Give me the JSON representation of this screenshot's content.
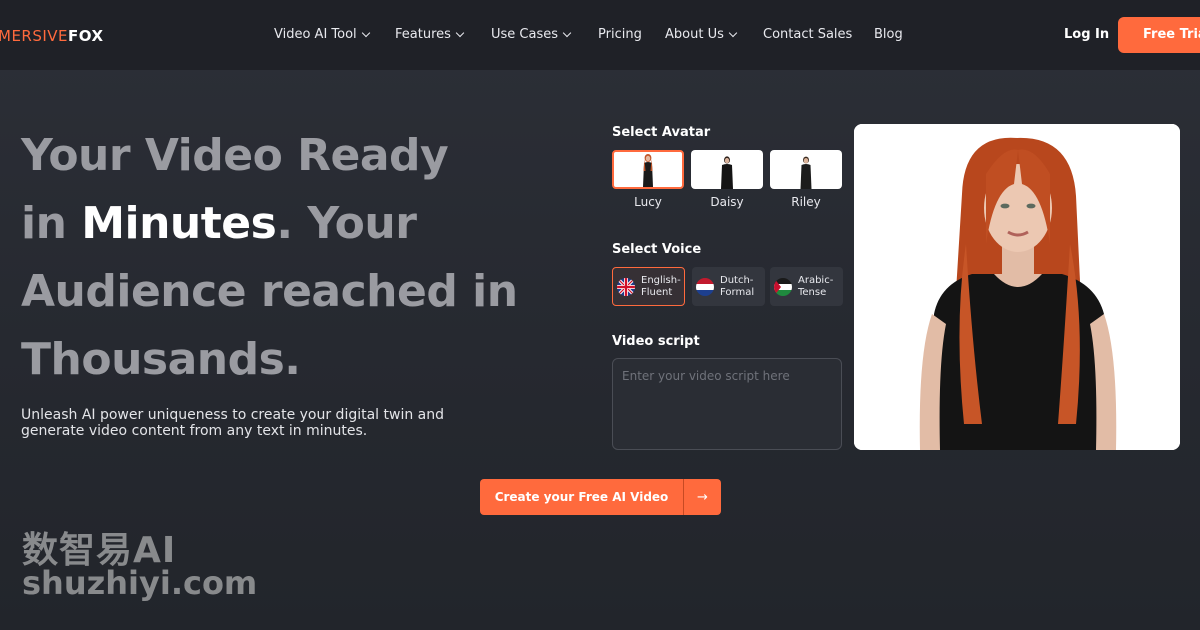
{
  "brand": {
    "logo_part1": "MERSIVE",
    "logo_part2": "FOX"
  },
  "nav": {
    "items": [
      {
        "label": "Video AI Tool",
        "dropdown": true
      },
      {
        "label": "Features",
        "dropdown": true
      },
      {
        "label": "Use Cases",
        "dropdown": true
      },
      {
        "label": "Pricing",
        "dropdown": false
      },
      {
        "label": "About Us",
        "dropdown": true
      },
      {
        "label": "Contact Sales",
        "dropdown": false
      },
      {
        "label": "Blog",
        "dropdown": false
      }
    ],
    "login": "Log In",
    "trial": "Free Trial"
  },
  "hero": {
    "line1": "Your Video Ready",
    "line2_pre": "in ",
    "line2_highlight": "Minutes",
    "line2_post": ". Your",
    "line3": "Audience reached in",
    "line4": "Thousands.",
    "subtext": "Unleash AI power uniqueness to create your digital twin and generate video content from any text in minutes."
  },
  "panel": {
    "avatar_label": "Select Avatar",
    "avatars": [
      {
        "name": "Lucy",
        "selected": true
      },
      {
        "name": "Daisy",
        "selected": false
      },
      {
        "name": "Riley",
        "selected": false
      }
    ],
    "voice_label": "Select Voice",
    "voices": [
      {
        "line1": "English-",
        "line2": "Fluent",
        "flag": "uk-flag-icon",
        "selected": true
      },
      {
        "line1": "Dutch-",
        "line2": "Formal",
        "flag": "netherlands-flag-icon",
        "selected": false
      },
      {
        "line1": "Arabic-",
        "line2": "Tense",
        "flag": "arabic-flag-icon",
        "selected": false
      }
    ],
    "script_label": "Video script",
    "script_placeholder": "Enter your video script here"
  },
  "cta": {
    "label": "Create your Free AI Video",
    "arrow": "→"
  },
  "watermark": {
    "line1": "数智易AI",
    "line2": "shuzhiyi.com"
  },
  "colors": {
    "accent": "#ff6a3d",
    "background": "#2a2d34",
    "nav_background": "#1f2127"
  }
}
